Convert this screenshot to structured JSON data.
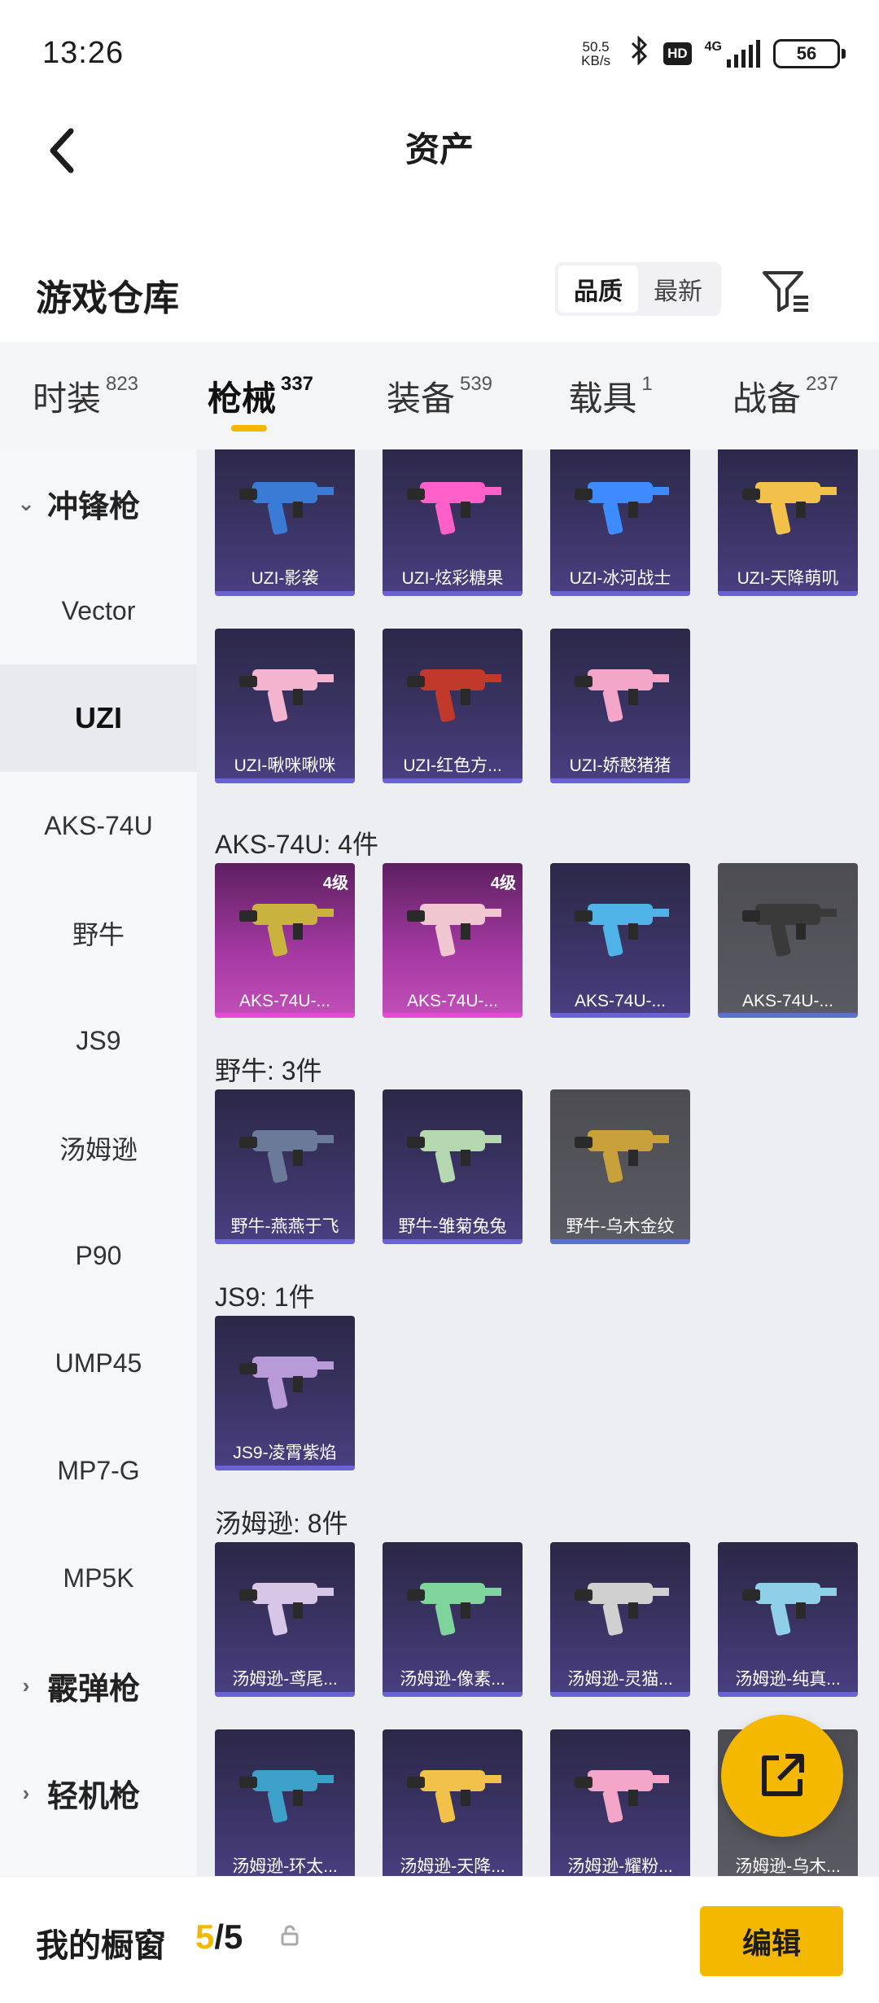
{
  "status": {
    "time": "13:26",
    "net_speed_value": "50.5",
    "net_speed_unit": "KB/s",
    "hd": "HD",
    "network": "4G",
    "battery": "56"
  },
  "nav": {
    "title": "资产"
  },
  "warehouse": {
    "title": "游戏仓库",
    "sort_options": [
      "品质",
      "最新"
    ],
    "active_sort": "品质"
  },
  "tabs": [
    {
      "label": "时装",
      "count": "823"
    },
    {
      "label": "枪械",
      "count": "337"
    },
    {
      "label": "装备",
      "count": "539"
    },
    {
      "label": "载具",
      "count": "1"
    },
    {
      "label": "战备",
      "count": "237"
    }
  ],
  "active_tab": "枪械",
  "sidebar": [
    {
      "label": "冲锋枪",
      "type": "group",
      "expanded": true
    },
    {
      "label": "Vector",
      "type": "item"
    },
    {
      "label": "UZI",
      "type": "item",
      "selected": true
    },
    {
      "label": "AKS-74U",
      "type": "item"
    },
    {
      "label": "野牛",
      "type": "item"
    },
    {
      "label": "JS9",
      "type": "item"
    },
    {
      "label": "汤姆逊",
      "type": "item"
    },
    {
      "label": "P90",
      "type": "item"
    },
    {
      "label": "UMP45",
      "type": "item"
    },
    {
      "label": "MP7-G",
      "type": "item"
    },
    {
      "label": "MP5K",
      "type": "item"
    },
    {
      "label": "霰弹枪",
      "type": "group",
      "expanded": false
    },
    {
      "label": "轻机枪",
      "type": "group",
      "expanded": false
    }
  ],
  "sections": [
    {
      "title": "",
      "cards": [
        {
          "name": "UZI-影袭",
          "color": "#3a7bd5"
        },
        {
          "name": "UZI-炫彩糖果",
          "color": "#ff5fc8"
        },
        {
          "name": "UZI-冰河战士",
          "color": "#3d8bff"
        },
        {
          "name": "UZI-天降萌叽",
          "color": "#f2c14a"
        },
        {
          "name": "UZI-啾咪啾咪",
          "color": "#f4b3cf"
        },
        {
          "name": "UZI-红色方...",
          "color": "#c0392b"
        },
        {
          "name": "UZI-娇憨猪猪",
          "color": "#f4a6c9"
        }
      ]
    },
    {
      "title": "AKS-74U: 4件",
      "cards": [
        {
          "name": "AKS-74U-...",
          "level": "4级",
          "color": "#c9b23d"
        },
        {
          "name": "AKS-74U-...",
          "level": "4级",
          "color": "#f0c6d0"
        },
        {
          "name": "AKS-74U-...",
          "color": "#4fb3e8"
        },
        {
          "name": "AKS-74U-...",
          "color": "#3a3a3a"
        }
      ]
    },
    {
      "title": "野牛: 3件",
      "cards": [
        {
          "name": "野牛-燕燕于飞",
          "color": "#6b7a99"
        },
        {
          "name": "野牛-雏菊兔兔",
          "color": "#b6d8b0"
        },
        {
          "name": "野牛-乌木金纹",
          "color": "#c9a13b"
        }
      ]
    },
    {
      "title": "JS9: 1件",
      "cards": [
        {
          "name": "JS9-凌霄紫焰",
          "color": "#b89ad8"
        }
      ]
    },
    {
      "title": "汤姆逊: 8件",
      "cards": [
        {
          "name": "汤姆逊-鸢尾...",
          "color": "#d8c6e6"
        },
        {
          "name": "汤姆逊-像素...",
          "color": "#7ed49a"
        },
        {
          "name": "汤姆逊-灵猫...",
          "color": "#d0d0d0"
        },
        {
          "name": "汤姆逊-纯真...",
          "color": "#8fd0e8"
        },
        {
          "name": "汤姆逊-环太...",
          "color": "#3da0c8"
        },
        {
          "name": "汤姆逊-天降...",
          "color": "#f2c14a"
        },
        {
          "name": "汤姆逊-耀粉...",
          "color": "#f4a6c9"
        },
        {
          "name": "汤姆逊-乌木...",
          "color": "#5a5a5a"
        }
      ]
    }
  ],
  "bottom": {
    "title": "我的橱窗",
    "count_current": "5",
    "count_total": "/5",
    "edit_label": "编辑"
  },
  "fab_icon": "share-external-icon"
}
